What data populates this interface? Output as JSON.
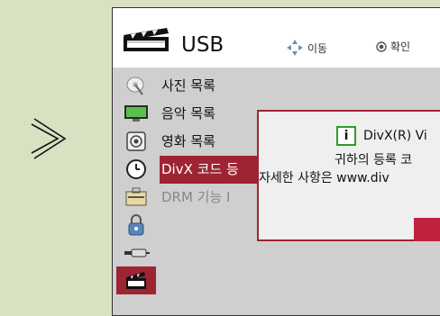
{
  "header": {
    "title": "USB",
    "nav_label": "이동",
    "ok_label": "확인"
  },
  "menu": {
    "items": [
      {
        "label": "사진 목록",
        "icon": "satellite-dish-icon"
      },
      {
        "label": "음악 목록",
        "icon": "monitor-icon"
      },
      {
        "label": "영화 목록",
        "icon": "speaker-icon"
      },
      {
        "label": "DivX 코드 등",
        "icon": "clock-icon"
      },
      {
        "label": "DRM 기능 I",
        "icon": "toolbox-icon"
      },
      {
        "label": "",
        "icon": "lock-icon"
      },
      {
        "label": "",
        "icon": "usb-plug-icon"
      },
      {
        "label": "",
        "icon": "clapperboard-icon"
      }
    ],
    "active_index": 3
  },
  "popup": {
    "line1": "DivX(R) Vi",
    "line2": "귀하의 등록 코",
    "line3": "자세한 사항은 www.div"
  },
  "colors": {
    "accent": "#9e2433",
    "background": "#d9e1c3",
    "menu_bg": "#cfcfcf"
  }
}
